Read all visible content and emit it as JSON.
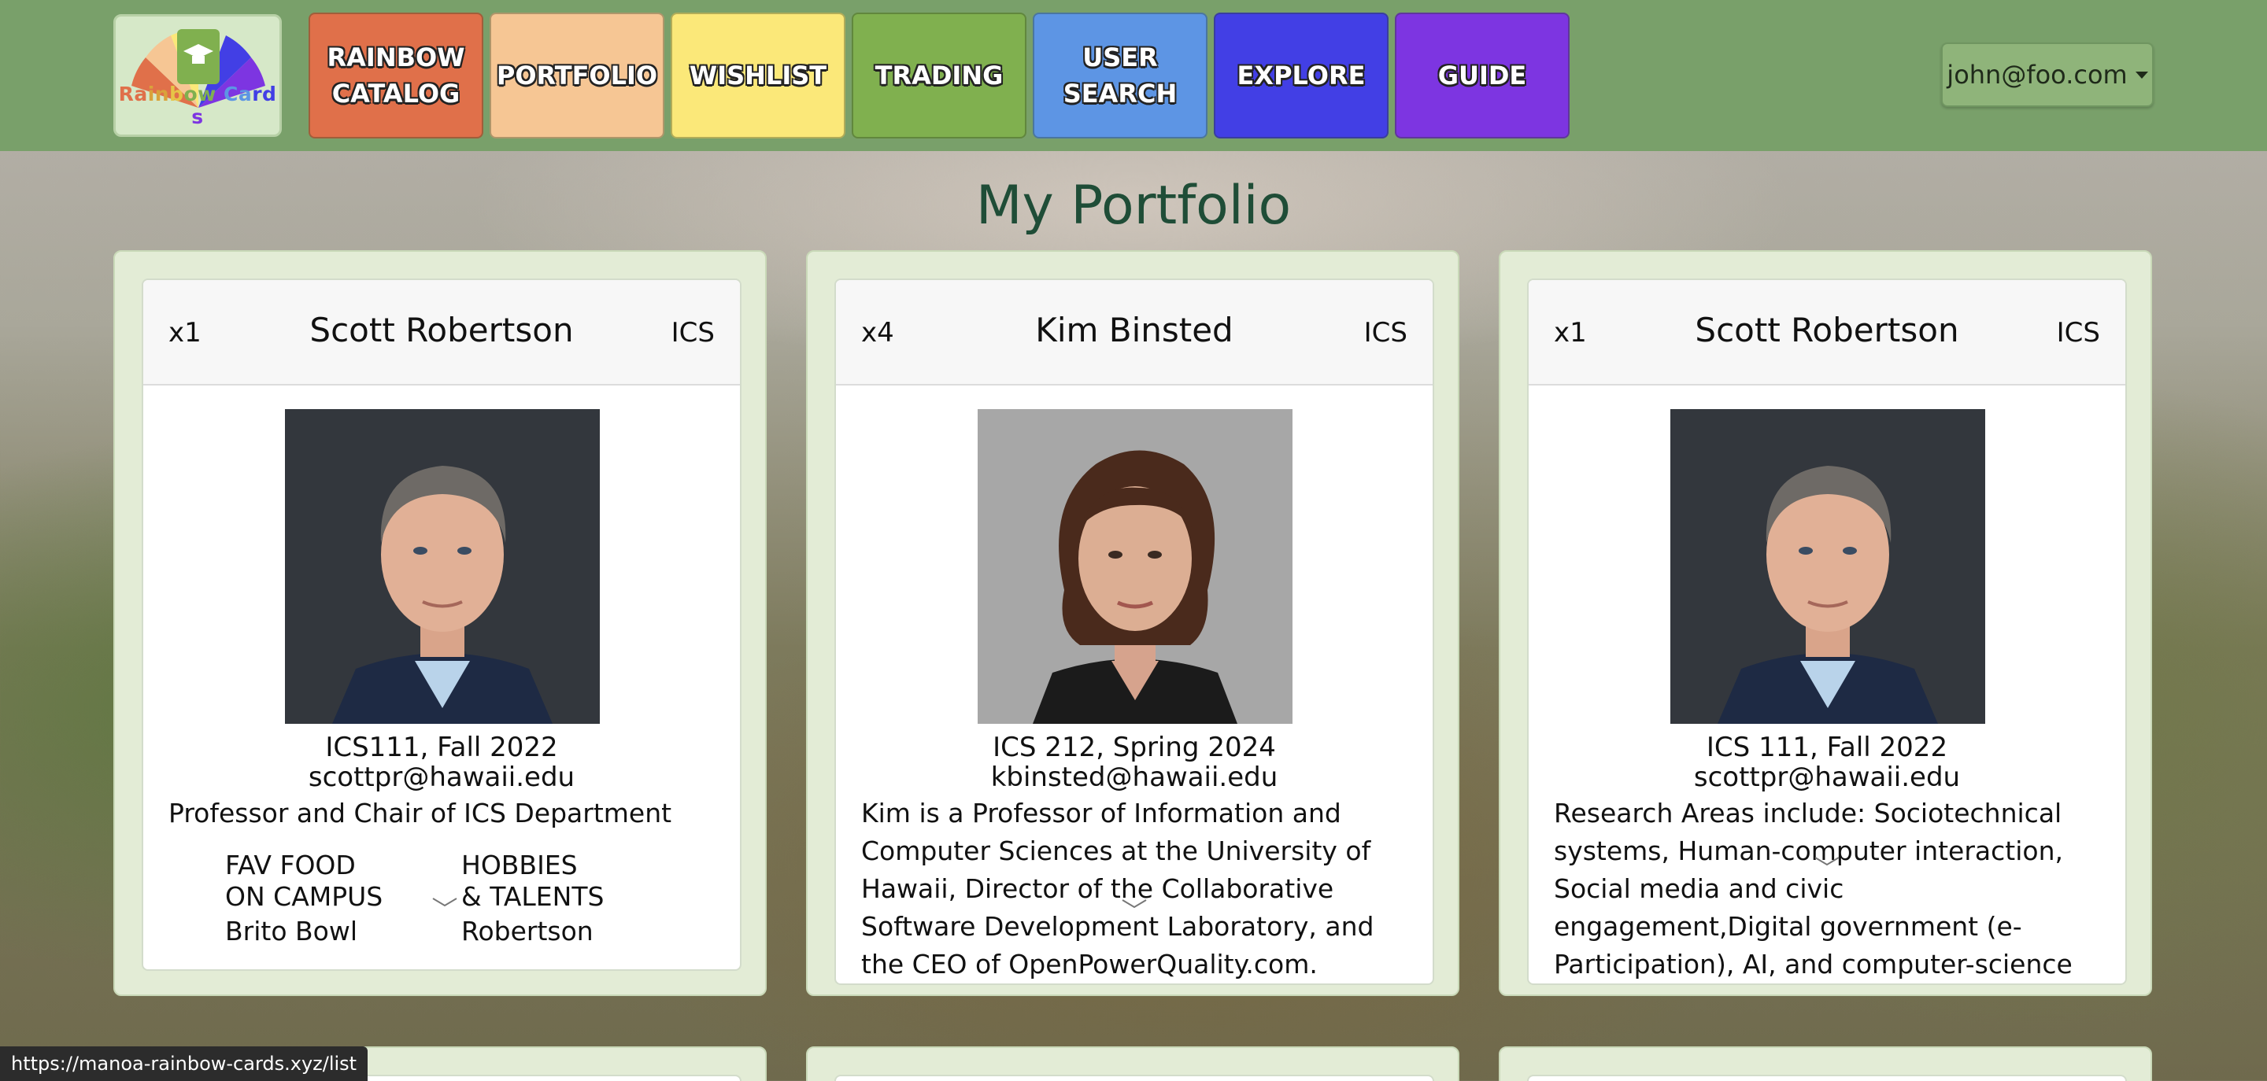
{
  "brand": {
    "logo_text": "Rainbow Cards"
  },
  "nav": [
    {
      "label": "RAINBOW\nCATALOG",
      "color": "#e0704a"
    },
    {
      "label": "PORTFOLIO",
      "color": "#f6c694"
    },
    {
      "label": "WISHLIST",
      "color": "#fbe879"
    },
    {
      "label": "TRADING",
      "color": "#80b04f"
    },
    {
      "label": "USER\nSEARCH",
      "color": "#5d95e4"
    },
    {
      "label": "EXPLORE",
      "color": "#423fe5"
    },
    {
      "label": "GUIDE",
      "color": "#7d35e1"
    }
  ],
  "user_menu": {
    "label": "john@foo.com"
  },
  "page": {
    "title": "My Portfolio"
  },
  "cards": [
    {
      "qty": "x1",
      "name": "Scott Robertson",
      "dept": "ICS",
      "course": "ICS111, Fall 2022",
      "email": "scottpr@hawaii.edu",
      "description": "Professor and Chair of ICS Department",
      "fav_food_label": "FAV FOOD\nON CAMPUS",
      "fav_food": "Brito Bowl",
      "hobbies_label": "HOBBIES\n& TALENTS",
      "hobbies": "Robertson"
    },
    {
      "qty": "x4",
      "name": "Kim Binsted",
      "dept": "ICS",
      "course": "ICS 212, Spring 2024",
      "email": "kbinsted@hawaii.edu",
      "description": "Kim is a Professor of Information and Computer Sciences at the University of Hawaii, Director of the Collaborative Software Development Laboratory, and the CEO of OpenPowerQuality.com."
    },
    {
      "qty": "x1",
      "name": "Scott Robertson",
      "dept": "ICS",
      "course": "ICS 111, Fall 2022",
      "email": "scottpr@hawaii.edu",
      "description": "Research Areas include: Sociotechnical systems, Human-computer interaction, Social media and civic engagement,Digital government (e-Participation), AI, and computer-science education"
    }
  ],
  "status_bar": {
    "url": "https://manoa-rainbow-cards.xyz/list"
  }
}
